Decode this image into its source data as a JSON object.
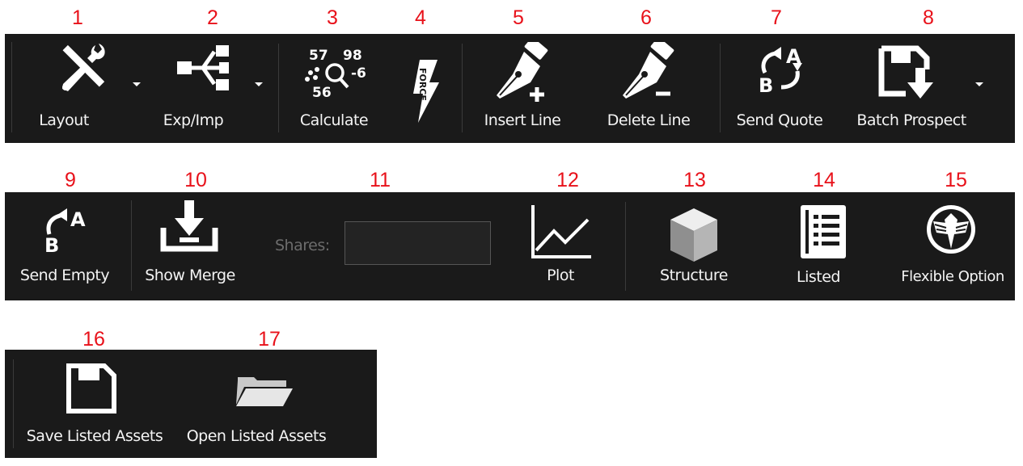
{
  "callouts": [
    "1",
    "2",
    "3",
    "4",
    "5",
    "6",
    "7",
    "8",
    "9",
    "10",
    "11",
    "12",
    "13",
    "14",
    "15",
    "16",
    "17"
  ],
  "toolbar1": {
    "layout": "Layout",
    "exp_imp": "Exp/Imp",
    "calculate": "Calculate",
    "calc_nums": [
      "57",
      "98",
      "-6",
      "56"
    ],
    "force_text": "FORCE",
    "insert_line": "Insert Line",
    "delete_line": "Delete Line",
    "send_quote": "Send Quote",
    "send_quote_letters": [
      "A",
      "B"
    ],
    "batch_prospect": "Batch Prospect"
  },
  "toolbar2": {
    "send_empty": "Send Empty",
    "send_empty_letters": [
      "A",
      "B"
    ],
    "show_merge": "Show Merge",
    "shares_label": "Shares:",
    "shares_value": "",
    "plot": "Plot",
    "structure": "Structure",
    "listed": "Listed",
    "flexible_option": "Flexible Option"
  },
  "toolbar3": {
    "save_listed_assets": "Save Listed Assets",
    "open_listed_assets": "Open Listed Assets"
  },
  "colors": {
    "callout": "#e8111a",
    "toolbar_bg": "#1a1a1a",
    "icon": "#ffffff"
  }
}
